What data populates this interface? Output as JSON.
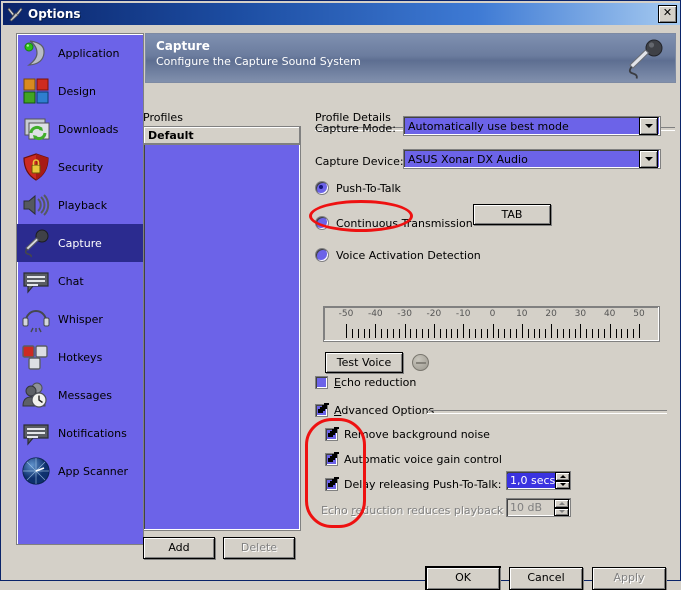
{
  "window": {
    "title": "Options",
    "icon": "tools-icon",
    "close_label": "✕"
  },
  "sidebar": {
    "items": [
      {
        "label": "Application",
        "icon": "application-icon",
        "selected": false
      },
      {
        "label": "Design",
        "icon": "design-icon",
        "selected": false
      },
      {
        "label": "Downloads",
        "icon": "downloads-icon",
        "selected": false
      },
      {
        "label": "Security",
        "icon": "security-shield-icon",
        "selected": false
      },
      {
        "label": "Playback",
        "icon": "playback-speaker-icon",
        "selected": false
      },
      {
        "label": "Capture",
        "icon": "capture-microphone-icon",
        "selected": true
      },
      {
        "label": "Chat",
        "icon": "chat-icon",
        "selected": false
      },
      {
        "label": "Whisper",
        "icon": "whisper-headset-icon",
        "selected": false
      },
      {
        "label": "Hotkeys",
        "icon": "hotkeys-icon",
        "selected": false
      },
      {
        "label": "Messages",
        "icon": "messages-icon",
        "selected": false
      },
      {
        "label": "Notifications",
        "icon": "notifications-icon",
        "selected": false
      },
      {
        "label": "App Scanner",
        "icon": "app-scanner-icon",
        "selected": false
      }
    ]
  },
  "banner": {
    "title": "Capture",
    "subtitle": "Configure the Capture Sound System",
    "icon": "microphone-icon"
  },
  "profiles": {
    "label": "Profiles",
    "items": [
      "Default"
    ],
    "add_label": "Add",
    "delete_label": "Delete",
    "delete_disabled": true
  },
  "details": {
    "label": "Profile Details",
    "capture_mode_label": "Capture Mode:",
    "capture_mode_value": "Automatically use best mode",
    "capture_device_label": "Capture Device:",
    "capture_device_value": "ASUS Xonar DX Audio",
    "modes": [
      {
        "label": "Push-To-Talk",
        "checked": true
      },
      {
        "label": "Continuous Transmission",
        "checked": false
      },
      {
        "label": "Voice Activation Detection",
        "checked": false
      }
    ],
    "hotkey_button": "TAB",
    "ruler": {
      "ticks": [
        "-50",
        "-40",
        "-30",
        "-20",
        "-10",
        "0",
        "10",
        "20",
        "30",
        "40",
        "50"
      ],
      "min": -50,
      "max": 50
    },
    "test_voice_label": "Test Voice",
    "echo_reduction": {
      "label": "Echo reduction",
      "accel": "E",
      "checked": false
    },
    "advanced_options": {
      "label": "Advanced Options",
      "accel": "A",
      "checked": true
    },
    "advanced_items": [
      {
        "label": "Remove background noise",
        "checked": true
      },
      {
        "label": "Automatic voice gain control",
        "checked": true
      },
      {
        "label": "Delay releasing Push-To-Talk:",
        "checked": true
      }
    ],
    "delay_value": "1,0 secs",
    "echo_playback_label": "Echo reduction reduces playback by:",
    "echo_playback_accel": "r",
    "echo_playback_value": "10 dB",
    "echo_playback_disabled": true
  },
  "footer": {
    "ok_label": "OK",
    "cancel_label": "Cancel",
    "apply_label": "Apply",
    "apply_disabled": true
  },
  "annotations": [
    {
      "name": "push-to-talk-highlight",
      "color": "#ee1111"
    },
    {
      "name": "advanced-options-highlight",
      "color": "#ee1111"
    }
  ],
  "colors": {
    "window_bg": "#d4d0c8",
    "accent_purple": "#6c63e8",
    "title_dark": "#0a246a",
    "title_light": "#a6caf0",
    "annotation_red": "#ee1111",
    "selected_sidebar": "#2b2b8f"
  }
}
